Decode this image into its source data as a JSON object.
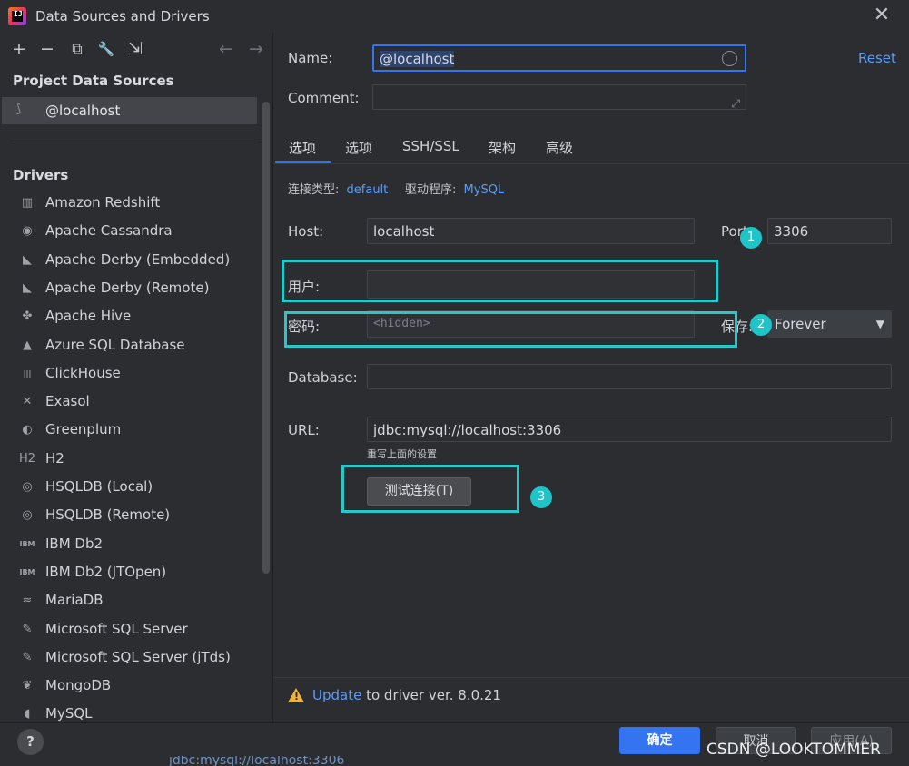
{
  "window": {
    "title": "Data Sources and Drivers",
    "close": "✕"
  },
  "toolbar": {
    "add": "+",
    "remove": "−",
    "copy": "⧉",
    "settings": "🔧",
    "import": "⇲",
    "back": "←",
    "forward": "→"
  },
  "sidebar": {
    "project_header": "Project Data Sources",
    "data_source": "@localhost",
    "drivers_header": "Drivers",
    "drivers": [
      {
        "label": "Amazon Redshift",
        "icon": "▥"
      },
      {
        "label": "Apache Cassandra",
        "icon": "◉"
      },
      {
        "label": "Apache Derby (Embedded)",
        "icon": "◣"
      },
      {
        "label": "Apache Derby (Remote)",
        "icon": "◣"
      },
      {
        "label": "Apache Hive",
        "icon": "✤"
      },
      {
        "label": "Azure SQL Database",
        "icon": "▲"
      },
      {
        "label": "ClickHouse",
        "icon": "|||"
      },
      {
        "label": "Exasol",
        "icon": "✕"
      },
      {
        "label": "Greenplum",
        "icon": "◐"
      },
      {
        "label": "H2",
        "icon": "H2"
      },
      {
        "label": "HSQLDB (Local)",
        "icon": "◎"
      },
      {
        "label": "HSQLDB (Remote)",
        "icon": "◎"
      },
      {
        "label": "IBM Db2",
        "icon": "IBM"
      },
      {
        "label": "IBM Db2 (JTOpen)",
        "icon": "IBM"
      },
      {
        "label": "MariaDB",
        "icon": "≈"
      },
      {
        "label": "Microsoft SQL Server",
        "icon": "✎"
      },
      {
        "label": "Microsoft SQL Server (jTds)",
        "icon": "✎"
      },
      {
        "label": "MongoDB",
        "icon": "❦"
      },
      {
        "label": "MySQL",
        "icon": "◖"
      }
    ]
  },
  "form": {
    "name_label": "Name:",
    "name_value": "@localhost",
    "comment_label": "Comment:",
    "reset": "Reset",
    "tabs": [
      "选项",
      "选项",
      "SSH/SSL",
      "架构",
      "高级"
    ],
    "conn_type_label": "连接类型:",
    "conn_type_value": "default",
    "driver_label": "驱动程序:",
    "driver_value": "MySQL",
    "host_label": "Host:",
    "host_value": "localhost",
    "port_label": "Port:",
    "port_value": "3306",
    "user_label": "用户:",
    "user_value": "",
    "password_label": "密码:",
    "password_placeholder": "<hidden>",
    "save_label": "保存:",
    "save_value": "Forever",
    "database_label": "Database:",
    "database_value": "",
    "url_label": "URL:",
    "url_value": "jdbc:mysql://localhost:3306",
    "url_hint": "重写上面的设置",
    "test_button": "测试连接(T)"
  },
  "annotations": [
    "1",
    "2",
    "3"
  ],
  "warning": {
    "link": "Update",
    "text": "to driver ver. 8.0.21"
  },
  "footer": {
    "help": "?",
    "ok": "确定",
    "cancel": "取消",
    "apply": "应用(A)",
    "watermark": "CSDN @LOOKTOMMER",
    "behind_text": "jdbc:mysql://localhost:3306"
  },
  "colors": {
    "accent": "#3574f0",
    "link": "#5a9cf8",
    "highlight": "#28c8c8",
    "warning": "#f2b33d"
  }
}
